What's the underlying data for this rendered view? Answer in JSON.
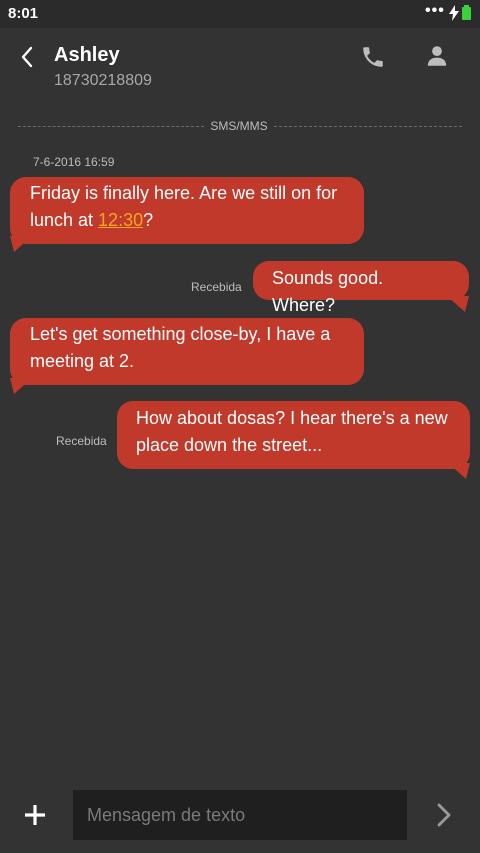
{
  "status_bar": {
    "time": "8:01",
    "overflow": "•••",
    "icons": [
      "charging-bolt-icon",
      "battery-icon"
    ],
    "battery_color": "#3ad13a"
  },
  "header": {
    "contact_name": "Ashley",
    "contact_number": "18730218809",
    "icons": [
      "back-chevron-icon",
      "phone-icon",
      "person-icon"
    ]
  },
  "thread": {
    "channel_label": "SMS/MMS",
    "timestamp": "7-6-2016 16:59",
    "messages": [
      {
        "direction": "incoming",
        "text_before": "Friday is finally here. Are we still on for lunch at ",
        "link": "12:30",
        "text_after": "?"
      },
      {
        "direction": "outgoing",
        "text": "Sounds good. Where?",
        "status": "Recebida"
      },
      {
        "direction": "incoming",
        "text": "Let's get something close-by, I have a meeting at 2."
      },
      {
        "direction": "outgoing",
        "text": "How about dosas? I hear there's a new place down the street...",
        "status": "Recebida"
      }
    ],
    "bubble_color": "#c0392b",
    "link_color": "#f5a623"
  },
  "compose": {
    "placeholder": "Mensagem de texto",
    "value": "",
    "icons": [
      "plus-icon",
      "send-chevron-icon"
    ]
  },
  "colors": {
    "background": "#333333",
    "compose_field": "#1f1f1f"
  }
}
